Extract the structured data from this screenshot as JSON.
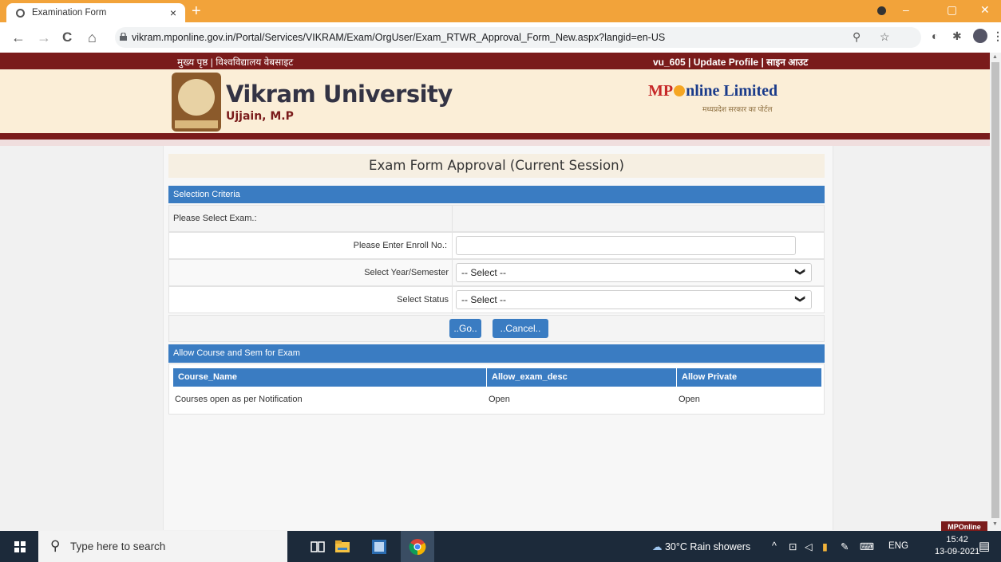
{
  "browser": {
    "tab_title": "Examination Form",
    "tab_close": "×",
    "new_tab": "+",
    "url": "vikram.mponline.gov.in/Portal/Services/VIKRAM/Exam/OrgUser/Exam_RTWR_Approval_Form_New.aspx?langid=en-US",
    "minimize": "–",
    "maximize": "▢",
    "close": "✕",
    "back": "←",
    "forward": "→",
    "reload": "C",
    "home": "⌂",
    "zoom_icon": "⚲",
    "star_icon": "☆",
    "ext1_icon": "◐",
    "ext2_icon": "✱",
    "menu_icon": "⋮"
  },
  "topbar": {
    "home_link": "मुख्य पृष्ठ",
    "separator": "|",
    "university_site_link": "विश्वविद्यालय वेबसाइट",
    "username": "vu_605",
    "update_profile": "Update Profile",
    "signout": "साइन आउट"
  },
  "header": {
    "university_name": "Vikram University",
    "city": "Ujjain, M.P",
    "mponline_part1": "MP",
    "mponline_part2": "nline Limited",
    "mponline_tagline": "मध्यप्रदेश सरकार का पोर्टल"
  },
  "form": {
    "page_heading": "Exam Form Approval (Current Session)",
    "selection_header": "Selection Criteria",
    "select_exam_label": "Please Select Exam.:",
    "enroll_label": "Please Enter Enroll No.:",
    "enroll_value": "",
    "year_sem_label": "Select Year/Semester",
    "year_sem_value": "-- Select --",
    "status_label": "Select Status",
    "status_value": "-- Select --",
    "go_button": "..Go..",
    "cancel_button": "..Cancel..",
    "chevron": "❯"
  },
  "allow_section": {
    "header": "Allow Course and Sem for Exam",
    "columns": [
      "Course_Name",
      "Allow_exam_desc",
      "Allow Private"
    ],
    "rows": [
      [
        "Courses open as per Notification",
        "Open",
        "Open"
      ]
    ]
  },
  "footer_badge": "MPOnline",
  "taskbar": {
    "search_placeholder": "Type here to search",
    "weather": "30°C  Rain showers",
    "tray_up": "^",
    "lang": "ENG",
    "time": "15:42",
    "date": "13-09-2021"
  }
}
